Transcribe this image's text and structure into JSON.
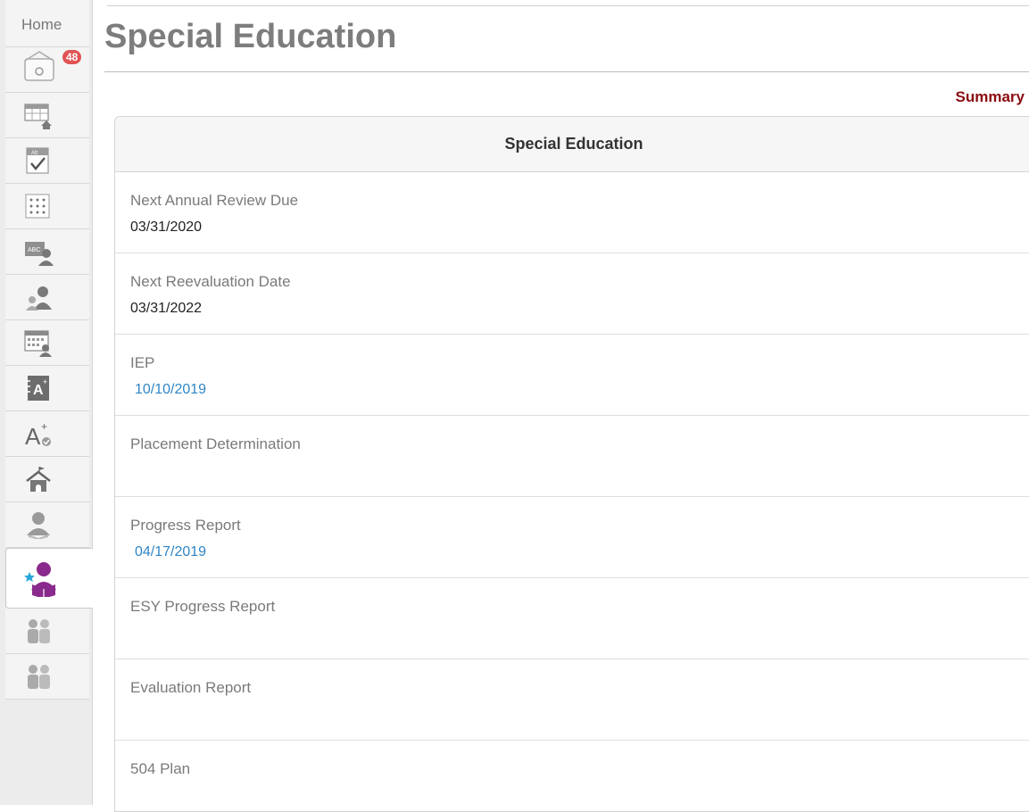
{
  "sidebar": {
    "home_label": "Home",
    "mail_badge": "48",
    "items": [
      {
        "name": "schedule-icon"
      },
      {
        "name": "attendance-icon"
      },
      {
        "name": "seating-chart-icon"
      },
      {
        "name": "class-roster-icon"
      },
      {
        "name": "student-group-icon"
      },
      {
        "name": "calendar-student-icon"
      },
      {
        "name": "gradebook-icon"
      },
      {
        "name": "grades-check-icon"
      },
      {
        "name": "school-icon"
      },
      {
        "name": "student-icon"
      },
      {
        "name": "special-education-icon"
      },
      {
        "name": "parents-icon"
      },
      {
        "name": "contacts-icon"
      }
    ],
    "active_color": "#8a2a8c",
    "star_color": "#2aa7d8"
  },
  "page": {
    "title": "Special Education",
    "summary_link": "Summary"
  },
  "panel": {
    "header": "Special Education",
    "fields": [
      {
        "label": "Next Annual Review Due",
        "value": "03/31/2020",
        "is_link": false
      },
      {
        "label": "Next Reevaluation Date",
        "value": "03/31/2022",
        "is_link": false
      },
      {
        "label": "IEP",
        "value": "10/10/2019",
        "is_link": true
      },
      {
        "label": "Placement Determination",
        "value": "",
        "is_link": false
      },
      {
        "label": "Progress Report",
        "value": "04/17/2019",
        "is_link": true
      },
      {
        "label": "ESY Progress Report",
        "value": "",
        "is_link": false
      },
      {
        "label": "Evaluation Report",
        "value": "",
        "is_link": false
      },
      {
        "label": "504 Plan",
        "value": "",
        "is_link": false
      }
    ]
  },
  "colors": {
    "summary_link": "#8b0d12",
    "date_link": "#2f86c6",
    "badge": "#e15354"
  }
}
